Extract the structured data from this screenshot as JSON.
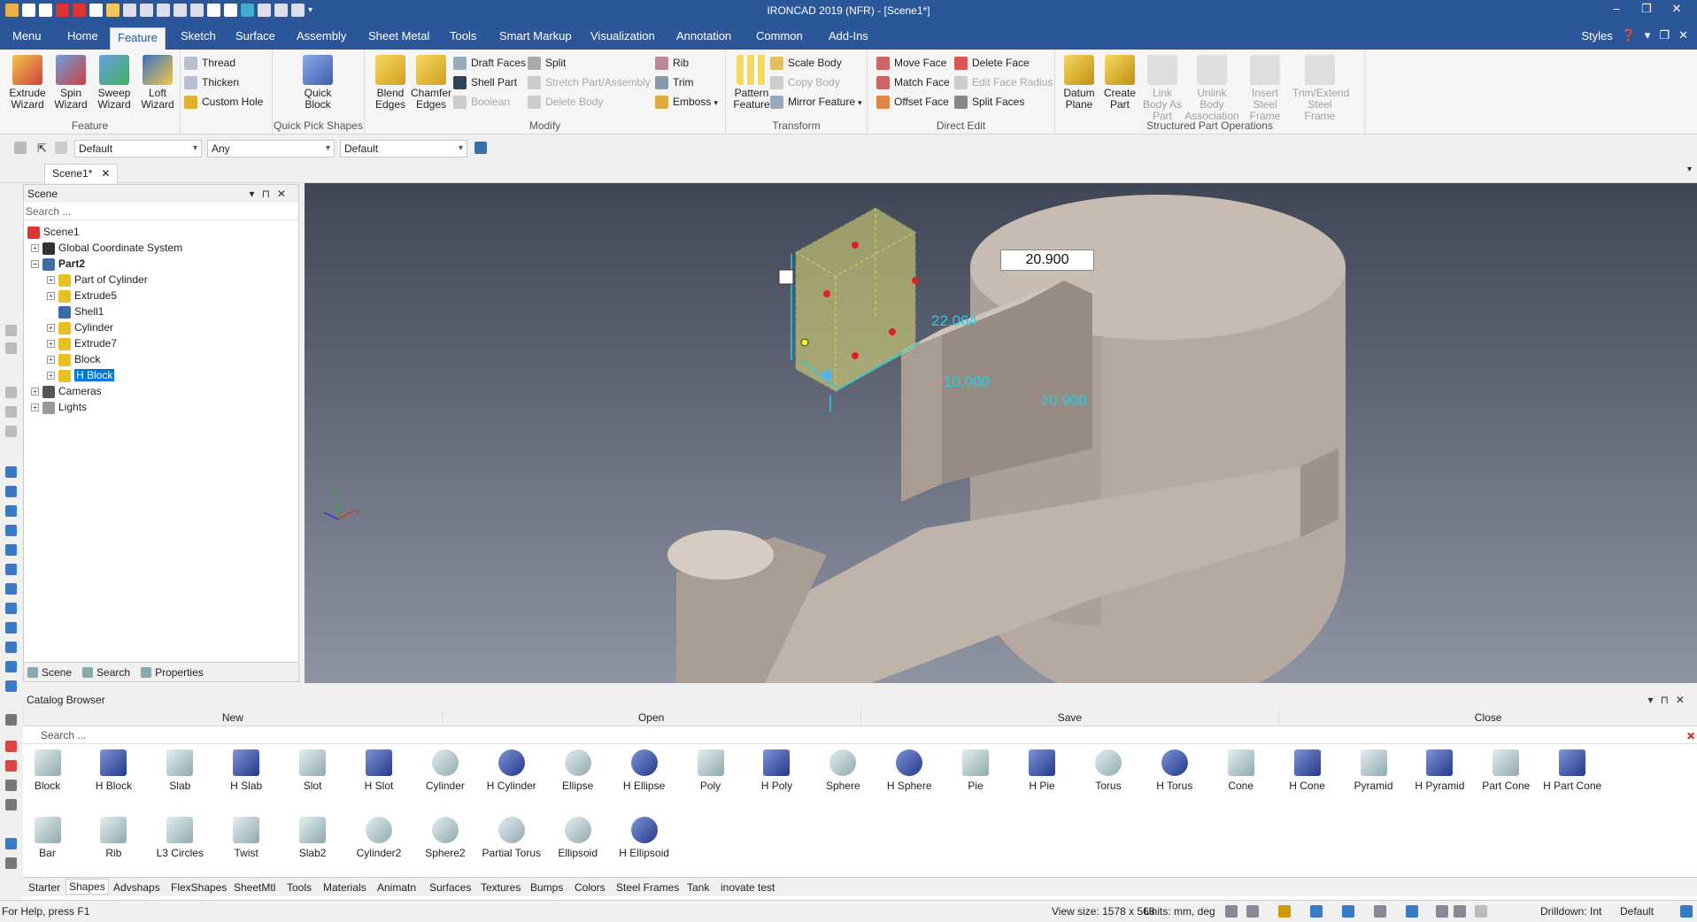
{
  "app": {
    "title": "IRONCAD 2019 (NFR) - [Scene1*]"
  },
  "menu": {
    "tabs": [
      "Menu",
      "Home",
      "Feature",
      "Sketch",
      "Surface",
      "Assembly",
      "Sheet Metal",
      "Tools",
      "Smart Markup",
      "Visualization",
      "Annotation",
      "Common",
      "Add-Ins"
    ],
    "active": "Feature",
    "styles": "Styles"
  },
  "ribbon": {
    "feature": {
      "label": "Feature",
      "extrude": "Extrude Wizard",
      "spin": "Spin Wizard",
      "sweep": "Sweep Wizard",
      "loft": "Loft Wizard",
      "thread": "Thread",
      "thicken": "Thicken",
      "custom_hole": "Custom Hole"
    },
    "quick": {
      "label": "Quick Pick Shapes",
      "quick_block": "Quick Block"
    },
    "modify": {
      "label": "Modify",
      "blend": "Blend Edges",
      "chamfer": "Chamfer Edges",
      "draft": "Draft Faces",
      "shell": "Shell Part",
      "boolean": "Boolean",
      "split": "Split",
      "stretch": "Stretch Part/Assembly",
      "delete_body": "Delete Body",
      "rib": "Rib",
      "trim": "Trim",
      "emboss": "Emboss"
    },
    "transform": {
      "label": "Transform",
      "pattern": "Pattern Feature",
      "scale": "Scale Body",
      "copy": "Copy Body",
      "mirror": "Mirror Feature"
    },
    "direct": {
      "label": "Direct Edit",
      "move": "Move Face",
      "match": "Match Face",
      "offset": "Offset Face",
      "delete_face": "Delete Face",
      "edit_radius": "Edit Face Radius",
      "split_faces": "Split Faces"
    },
    "structured": {
      "label": "Structured Part Operations",
      "datum": "Datum Plane",
      "create": "Create Part",
      "link": "Link Body As Part",
      "unlink": "Unlink Body Association",
      "insert": "Insert Steel Frame",
      "trimext": "Trim/Extend Steel Frame"
    }
  },
  "propbar": {
    "combo1": "Default",
    "combo2": "Any",
    "combo3": "Default"
  },
  "doc_tab": "Scene1*",
  "scene": {
    "header": "Scene",
    "search_placeholder": "Search ...",
    "nodes": [
      "Scene1",
      "Global Coordinate System",
      "Part2",
      "Part of Cylinder",
      "Extrude5",
      "Shell1",
      "Cylinder",
      "Extrude7",
      "Block",
      "H Block",
      "Cameras",
      "Lights"
    ],
    "footer": [
      "Scene",
      "Search",
      "Properties"
    ]
  },
  "viewport": {
    "dim_main": "20.900",
    "dim_height": "22.064",
    "dim_depth": "10.000",
    "dim_width": "20.900"
  },
  "catalog": {
    "title": "Catalog Browser",
    "actions": [
      "New",
      "Open",
      "Save",
      "Close"
    ],
    "search_placeholder": "Search ...",
    "shapes_row1": [
      "Block",
      "H Block",
      "Slab",
      "H Slab",
      "Slot",
      "H Slot",
      "Cylinder",
      "H Cylinder",
      "Ellipse",
      "H Ellipse",
      "Poly",
      "H Poly",
      "Sphere",
      "H Sphere",
      "Pie",
      "H Pie",
      "Torus",
      "H Torus",
      "Cone",
      "H Cone",
      "Pyramid",
      "H Pyramid",
      "Part Cone",
      "H Part Cone"
    ],
    "shapes_row2": [
      "Bar",
      "Rib",
      "L3 Circles",
      "Twist",
      "Slab2",
      "Cylinder2",
      "Sphere2",
      "Partial Torus",
      "Ellipsoid",
      "H Ellipsoid"
    ],
    "tabs": [
      "Starter",
      "Shapes",
      "Advshaps",
      "FlexShapes",
      "SheetMtl",
      "Tools",
      "Materials",
      "Animatn",
      "Surfaces",
      "Textures",
      "Bumps",
      "Colors",
      "Steel Frames",
      "Tank",
      "inovate test"
    ],
    "active_tab": "Shapes"
  },
  "status": {
    "help": "For Help, press F1",
    "view_size": "View size: 1578 x  568",
    "units": "Units: mm, deg",
    "drilldown": "Drilldown: Int",
    "style": "Default"
  }
}
